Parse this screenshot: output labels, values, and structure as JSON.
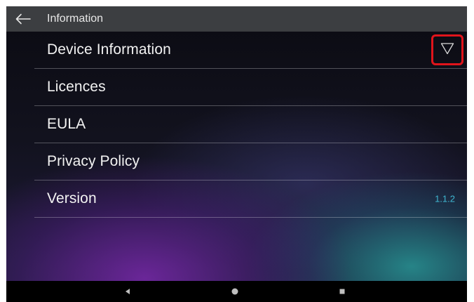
{
  "header": {
    "title": "Information",
    "back_icon": "arrow-left-icon"
  },
  "menu": {
    "items": [
      {
        "label": "Device Information",
        "value": "",
        "action_icon": "triangle-down-icon"
      },
      {
        "label": "Licences",
        "value": ""
      },
      {
        "label": "EULA",
        "value": ""
      },
      {
        "label": "Privacy Policy",
        "value": ""
      },
      {
        "label": "Version",
        "value": "1.1.2"
      }
    ]
  },
  "navbar": {
    "icons": [
      "nav-back-icon",
      "nav-home-icon",
      "nav-recents-icon"
    ]
  },
  "colors": {
    "topbar": "#3c3e41",
    "highlight": "#e0141b",
    "version_text": "#3fb6d0",
    "navbar": "#000000"
  }
}
